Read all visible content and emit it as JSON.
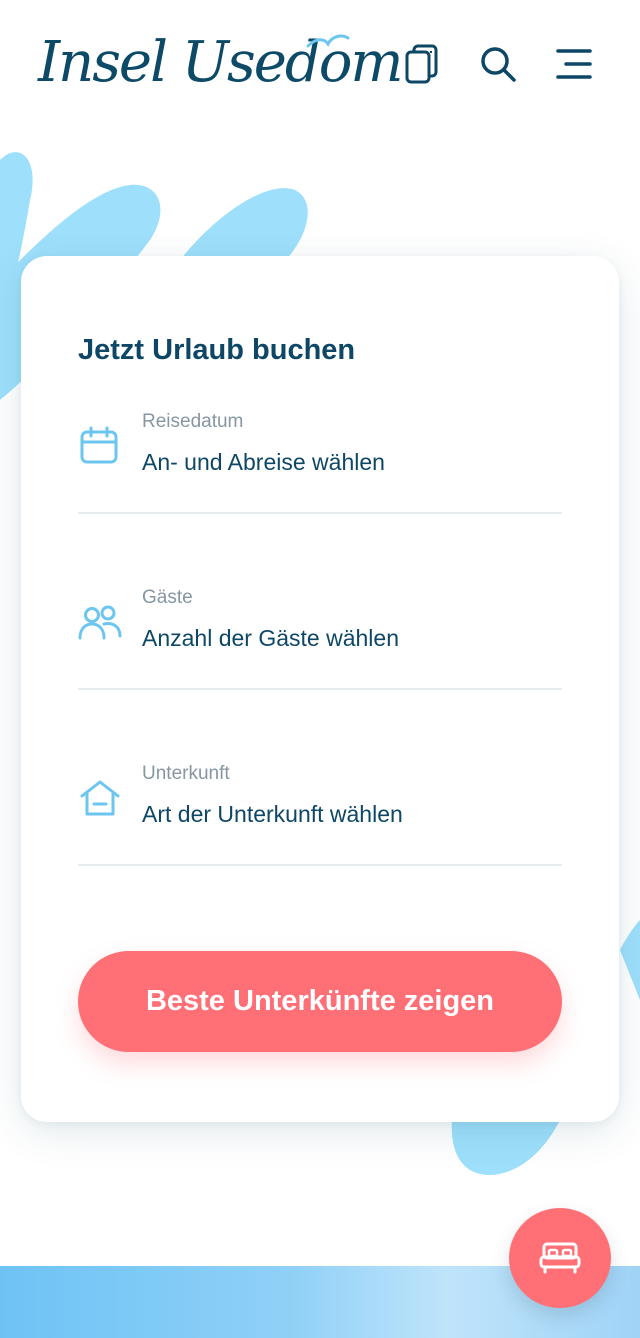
{
  "header": {
    "logo_text": "Insel Usedom",
    "icons": [
      "brochure-icon",
      "search-icon",
      "menu-icon"
    ]
  },
  "booking": {
    "title": "Jetzt Urlaub buchen",
    "fields": [
      {
        "icon": "calendar-icon",
        "label": "Reisedatum",
        "value": "An- und Abreise wählen"
      },
      {
        "icon": "guests-icon",
        "label": "Gäste",
        "value": "Anzahl der Gäste wählen"
      },
      {
        "icon": "house-icon",
        "label": "Unterkunft",
        "value": "Art der Unterkunft wählen"
      }
    ],
    "submit_label": "Beste Unterkünfte zeigen"
  },
  "fab": {
    "icon": "bed-icon"
  },
  "colors": {
    "brand_dark": "#0e4766",
    "accent_coral": "#ff6f76",
    "accent_sky": "#6cc6ef",
    "label_gray": "#8497a3"
  }
}
